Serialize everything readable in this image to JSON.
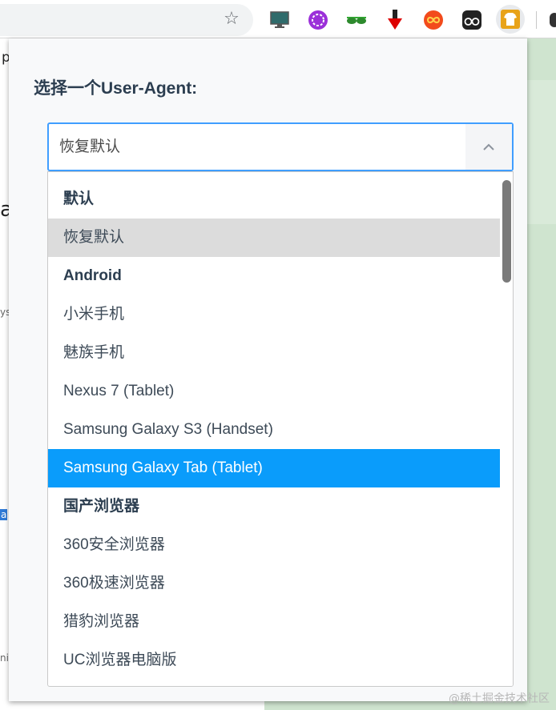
{
  "toolbar": {
    "star_icon": "star-icon",
    "extensions": [
      "monitor-icon",
      "purple-ext-icon",
      "glasses-icon",
      "download-arrow-icon",
      "infinity-icon",
      "dots-ext-icon",
      "tshirt-icon"
    ]
  },
  "background": {
    "left_fragment_1": "p",
    "left_fragment_2": "a",
    "left_fragment_3": "ys",
    "left_fragment_4": "a",
    "left_fragment_5": "ni"
  },
  "popup": {
    "title": "选择一个User-Agent:",
    "select": {
      "value": "恢复默认",
      "arrow_icon": "chevron-up-icon"
    },
    "options": [
      {
        "label": "默认",
        "type": "group"
      },
      {
        "label": "恢复默认",
        "type": "option",
        "state": "selected"
      },
      {
        "label": "Android",
        "type": "group"
      },
      {
        "label": "小米手机",
        "type": "option"
      },
      {
        "label": "魅族手机",
        "type": "option"
      },
      {
        "label": "Nexus 7 (Tablet)",
        "type": "option"
      },
      {
        "label": "Samsung Galaxy S3 (Handset)",
        "type": "option"
      },
      {
        "label": "Samsung Galaxy Tab (Tablet)",
        "type": "option",
        "state": "hover"
      },
      {
        "label": "国产浏览器",
        "type": "group"
      },
      {
        "label": "360安全浏览器",
        "type": "option"
      },
      {
        "label": "360极速浏览器",
        "type": "option"
      },
      {
        "label": "猎豹浏览器",
        "type": "option"
      },
      {
        "label": "UC浏览器电脑版",
        "type": "option"
      }
    ]
  },
  "watermark": "@稀土掘金技术社区",
  "colors": {
    "accent": "#409eff",
    "hover": "#0a9cfb",
    "selected": "#dcdcdc"
  }
}
